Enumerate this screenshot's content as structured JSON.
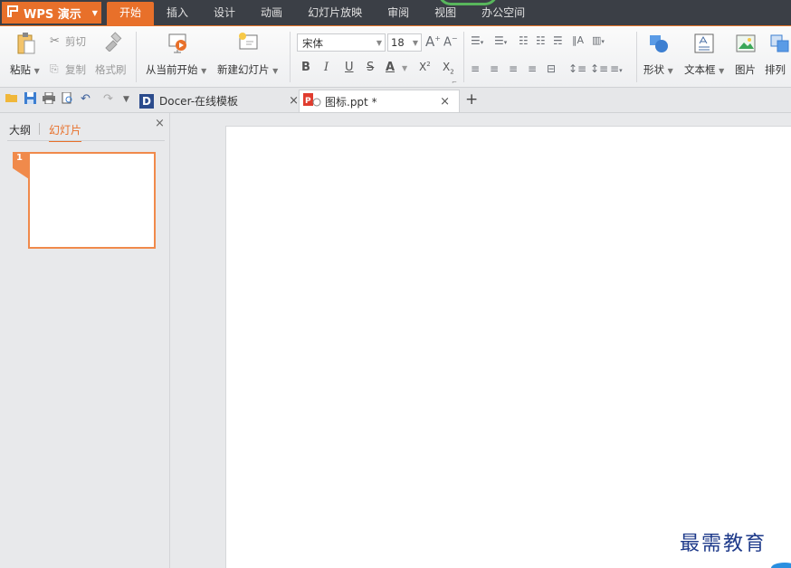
{
  "app": {
    "brand_label": "WPS 演示",
    "brand_icon": "wps-logo-icon",
    "accent": "#e8702a"
  },
  "menu": {
    "tabs": [
      {
        "label": "开始",
        "active": true
      },
      {
        "label": "插入"
      },
      {
        "label": "设计"
      },
      {
        "label": "动画"
      },
      {
        "label": "幻灯片放映"
      },
      {
        "label": "审阅"
      },
      {
        "label": "视图"
      },
      {
        "label": "办公空间"
      }
    ]
  },
  "ribbon": {
    "paste_label": "粘贴",
    "cut_label": "剪切",
    "copy_label": "复制",
    "format_painter_label": "格式刷",
    "from_current_label": "从当前开始",
    "new_slide_label": "新建幻灯片",
    "font_name": "宋体",
    "font_size": "18",
    "shape_label": "形状",
    "textbox_label": "文本框",
    "picture_label": "图片",
    "arrange_label": "排列"
  },
  "quickbar": {
    "tabs": [
      {
        "label": "Docer-在线模板",
        "active": false
      },
      {
        "label": "图标.ppt *",
        "active": true
      }
    ],
    "add_tab": "+"
  },
  "left_panel": {
    "outline_tab": "大纲",
    "slides_tab": "幻灯片",
    "close": "×",
    "slide_number": "1"
  },
  "watermark": "最需教育"
}
